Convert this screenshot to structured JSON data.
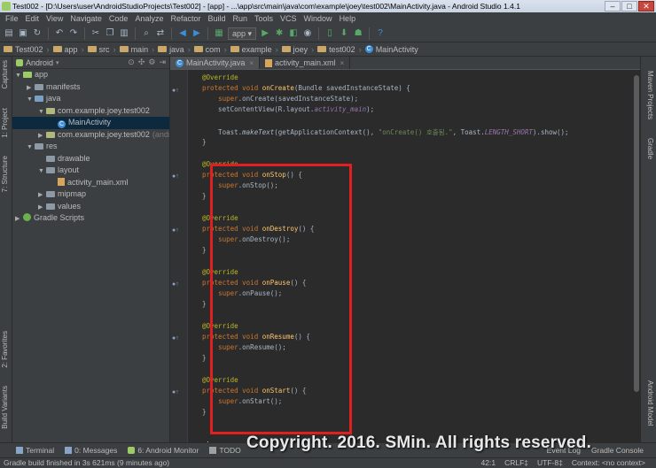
{
  "window": {
    "title": "Test002 - [D:\\Users\\user\\AndroidStudioProjects\\Test002] - [app] - ...\\app\\src\\main\\java\\com\\example\\joey\\test002\\MainActivity.java - Android Studio 1.4.1",
    "minimize": "–",
    "maximize": "□",
    "close": "✕"
  },
  "menu": [
    "File",
    "Edit",
    "View",
    "Navigate",
    "Code",
    "Analyze",
    "Refactor",
    "Build",
    "Run",
    "Tools",
    "VCS",
    "Window",
    "Help"
  ],
  "toolbar": {
    "run_config": "app ▾",
    "icons": [
      "open-icon",
      "save-icon",
      "sync-icon",
      "undo-icon",
      "redo-icon",
      "cut-icon",
      "copy-icon",
      "paste-icon",
      "find-icon",
      "replace-icon",
      "back-icon",
      "forward-icon",
      "make-icon",
      "run-icon",
      "debug-icon",
      "coverage-icon",
      "profile-icon",
      "avd-icon",
      "sdk-icon",
      "help-icon"
    ]
  },
  "breadcrumbs": [
    "Test002",
    "app",
    "src",
    "main",
    "java",
    "com",
    "example",
    "joey",
    "test002",
    "MainActivity"
  ],
  "left_tabs": [
    "Captures",
    "1: Project",
    "7: Structure",
    "2: Favorites",
    "Build Variants"
  ],
  "right_tabs": [
    "Maven Projects",
    "Gradle",
    "Android Model"
  ],
  "project": {
    "view": "Android",
    "tree": [
      {
        "label": "app",
        "depth": 0,
        "arrow": "▼",
        "icon": "app"
      },
      {
        "label": "manifests",
        "depth": 1,
        "arrow": "▶",
        "icon": "folder"
      },
      {
        "label": "java",
        "depth": 1,
        "arrow": "▼",
        "icon": "src"
      },
      {
        "label": "com.example.joey.test002",
        "depth": 2,
        "arrow": "▼",
        "icon": "pkg"
      },
      {
        "label": "MainActivity",
        "depth": 3,
        "arrow": "",
        "icon": "class",
        "selected": true
      },
      {
        "label": "com.example.joey.test002",
        "suffix": "(androidT",
        "depth": 2,
        "arrow": "▶",
        "icon": "pkg"
      },
      {
        "label": "res",
        "depth": 1,
        "arrow": "▼",
        "icon": "folder"
      },
      {
        "label": "drawable",
        "depth": 2,
        "arrow": "",
        "icon": "folder"
      },
      {
        "label": "layout",
        "depth": 2,
        "arrow": "▼",
        "icon": "folder"
      },
      {
        "label": "activity_main.xml",
        "depth": 3,
        "arrow": "",
        "icon": "xml"
      },
      {
        "label": "mipmap",
        "depth": 2,
        "arrow": "▶",
        "icon": "folder"
      },
      {
        "label": "values",
        "depth": 2,
        "arrow": "▶",
        "icon": "folder"
      },
      {
        "label": "Gradle Scripts",
        "depth": 0,
        "arrow": "▶",
        "icon": "gradle"
      }
    ]
  },
  "editor": {
    "tabs": [
      {
        "label": "MainActivity.java",
        "active": true,
        "icon": "class"
      },
      {
        "label": "activity_main.xml",
        "active": false,
        "icon": "xml"
      }
    ]
  },
  "bottom_tabs": [
    "Terminal",
    "0: Messages",
    "6: Android Monitor",
    "TODO"
  ],
  "bottom_right_tabs": [
    "Event Log",
    "Gradle Console"
  ],
  "status": {
    "message": "Gradle build finished in 3s 621ms (9 minutes ago)",
    "position": "42:1",
    "line_sep": "CRLF‡",
    "encoding": "UTF-8‡",
    "context": "Context: <no context>"
  },
  "watermark": "Copyright. 2016. SMin. All rights reserved."
}
